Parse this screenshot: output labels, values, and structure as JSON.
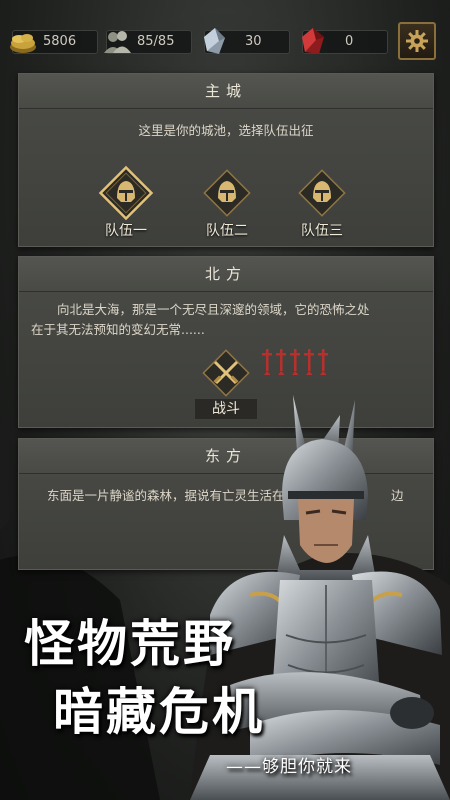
{
  "resources": {
    "gold": "5806",
    "population": "85/85",
    "crystal": "30",
    "ruby": "0"
  },
  "main_city": {
    "title": "主城",
    "description": "这里是你的城池，选择队伍出征",
    "teams": [
      "队伍一",
      "队伍二",
      "队伍三"
    ]
  },
  "north": {
    "title": "北方",
    "description_line1": "向北是大海，那是一个无尽且深邃的领域，它的恐怖之处",
    "description_line2": "在于其无法预知的变幻无常......",
    "battle_label": "战斗",
    "danger_level": 5
  },
  "east": {
    "title": "东方",
    "description": "东面是一片静谧的森林，据说有亡灵生活在",
    "description_tail": "边"
  },
  "promo": {
    "line1": "怪物荒野",
    "line2": "暗藏危机",
    "slogan": "——够胆你就来"
  }
}
